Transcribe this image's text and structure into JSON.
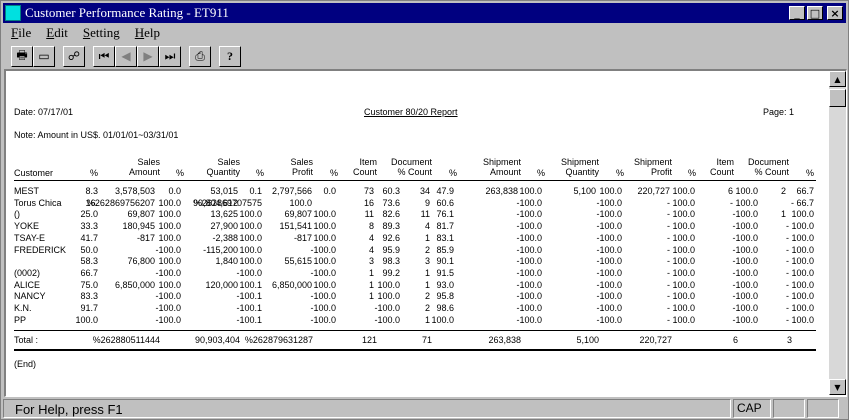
{
  "window": {
    "title": "Customer Performance Rating - ET911"
  },
  "menu": [
    {
      "key": "F",
      "rest": "ile"
    },
    {
      "key": "E",
      "rest": "dit"
    },
    {
      "key": "S",
      "rest": "etting"
    },
    {
      "key": "H",
      "rest": "elp"
    }
  ],
  "toolbar": [
    {
      "name": "print-icon",
      "glyph": "🖶"
    },
    {
      "name": "print-preview-icon",
      "glyph": "▭"
    },
    {
      "name": "setup-icon",
      "glyph": "☍"
    },
    {
      "name": "first-record-icon",
      "glyph": "⏮"
    },
    {
      "name": "prev-record-icon",
      "glyph": "◀",
      "disabled": true
    },
    {
      "name": "next-record-icon",
      "glyph": "▶",
      "disabled": true
    },
    {
      "name": "last-record-icon",
      "glyph": "⏭"
    },
    {
      "name": "printer-icon",
      "glyph": "⎙"
    },
    {
      "name": "help-icon",
      "glyph": "?"
    }
  ],
  "report": {
    "date": "Date: 07/17/01",
    "title": "Customer 80/20 Report",
    "page": "Page: 1",
    "note": "Note: Amount in US$. 01/01/01~03/31/01",
    "headers": [
      [
        "Customer"
      ],
      [
        "%"
      ],
      [
        "Sales",
        "Amount"
      ],
      [
        "%"
      ],
      [
        "Sales",
        "Quantity"
      ],
      [
        "%"
      ],
      [
        "Sales",
        "Profit"
      ],
      [
        "%"
      ],
      [
        "Item",
        "Count"
      ],
      [
        "Document",
        "% Count"
      ],
      [
        "%"
      ],
      [
        "Shipment",
        "Amount"
      ],
      [
        "%"
      ],
      [
        "Shipment",
        "Quantity"
      ],
      [
        "%"
      ],
      [
        "Shipment",
        "Profit"
      ],
      [
        "%"
      ],
      [
        "Item",
        "Count"
      ],
      [
        "Document",
        "% Count"
      ],
      [
        "%"
      ]
    ],
    "rows": [
      [
        "MEST",
        "8.3",
        "3,578,503",
        "0.0",
        "53,015",
        "0.1",
        "2,797,566",
        "0.0",
        "73",
        "60.3",
        "34",
        "47.9",
        "263,838",
        "100.0",
        "5,100",
        "100.0",
        "220,727",
        "100.0",
        "6",
        "100.0",
        "2",
        "66.7"
      ],
      [
        "Torus Chica",
        "16.",
        "%262869756207",
        "100.0",
        "90,804,612",
        "%262869707575",
        "100.0",
        "",
        "16",
        "73.6",
        "9",
        "60.6",
        "",
        "-100.0",
        "",
        "-100.0",
        "",
        "- 100.0",
        "",
        "- 100.0",
        "",
        "- 66.7"
      ],
      [
        "()",
        "25.0",
        "69,807",
        "100.0",
        "13,625",
        "100.0",
        "69,807",
        "100.0",
        "11",
        "82.6",
        "11",
        "76.1",
        "",
        "-100.0",
        "",
        "-100.0",
        "",
        "- 100.0",
        "",
        "-100.0",
        "1",
        "100.0"
      ],
      [
        "YOKE",
        "33.3",
        "180,945",
        "100.0",
        "27,900",
        "100.0",
        "151,541",
        "100.0",
        "8",
        "89.3",
        "4",
        "81.7",
        "",
        "-100.0",
        "",
        "-100.0",
        "",
        "- 100.0",
        "",
        "-100.0",
        "",
        "- 100.0"
      ],
      [
        "TSAY-E",
        "41.7",
        "-817",
        "100.0",
        "-2,388",
        "100.0",
        "-817",
        "100.0",
        "4",
        "92.6",
        "1",
        "83.1",
        "",
        "-100.0",
        "",
        "-100.0",
        "",
        "- 100.0",
        "",
        "-100.0",
        "",
        "- 100.0"
      ],
      [
        "FREDERICK",
        "50.0",
        "",
        "-100.0",
        "-115,200",
        "100.0",
        "",
        "-100.0",
        "4",
        "95.9",
        "2",
        "85.9",
        "",
        "-100.0",
        "",
        "-100.0",
        "",
        "- 100.0",
        "",
        "-100.0",
        "",
        "- 100.0"
      ],
      [
        "",
        "58.3",
        "76,800",
        "100.0",
        "1,840",
        "100.0",
        "55,615",
        "100.0",
        "3",
        "98.3",
        "3",
        "90.1",
        "",
        "-100.0",
        "",
        "-100.0",
        "",
        "- 100.0",
        "",
        "-100.0",
        "",
        "- 100.0"
      ],
      [
        "(0002)",
        "66.7",
        "",
        "-100.0",
        "",
        "-100.0",
        "",
        "-100.0",
        "1",
        "99.2",
        "1",
        "91.5",
        "",
        "-100.0",
        "",
        "-100.0",
        "",
        "- 100.0",
        "",
        "-100.0",
        "",
        "- 100.0"
      ],
      [
        "ALICE",
        "75.0",
        "6,850,000",
        "100.0",
        "120,000",
        "100.1",
        "6,850,000",
        "100.0",
        "1",
        "100.0",
        "1",
        "93.0",
        "",
        "-100.0",
        "",
        "-100.0",
        "",
        "- 100.0",
        "",
        "-100.0",
        "",
        "- 100.0"
      ],
      [
        "NANCY",
        "83.3",
        "",
        "-100.0",
        "",
        "-100.1",
        "",
        "-100.0",
        "1",
        "100.0",
        "2",
        "95.8",
        "",
        "-100.0",
        "",
        "-100.0",
        "",
        "- 100.0",
        "",
        "-100.0",
        "",
        "- 100.0"
      ],
      [
        "K.N.",
        "91.7",
        "",
        "-100.0",
        "",
        "-100.1",
        "",
        "-100.0",
        "",
        "-100.0",
        "2",
        "98.6",
        "",
        "-100.0",
        "",
        "-100.0",
        "",
        "- 100.0",
        "",
        "-100.0",
        "",
        "- 100.0"
      ],
      [
        "PP",
        "100.0",
        "",
        "-100.0",
        "",
        "-100.1",
        "",
        "-100.0",
        "",
        "-100.0",
        "1",
        "100.0",
        "",
        "-100.0",
        "",
        "-100.0",
        "",
        "- 100.0",
        "",
        "-100.0",
        "",
        "- 100.0"
      ]
    ],
    "total": {
      "label": "Total :",
      "sales_amount": "%262880511444",
      "sales_quantity": "90,903,404",
      "sales_profit": "%262879631287",
      "item_count": "121",
      "document_count": "71",
      "shipment_amount": "263,838",
      "shipment_quantity": "5,100",
      "shipment_profit": "220,727",
      "ship_item_count": "6",
      "ship_document_count": "3"
    },
    "end": "(End)"
  },
  "status": {
    "help_text": "For Help, press F1",
    "cap": "CAP"
  }
}
